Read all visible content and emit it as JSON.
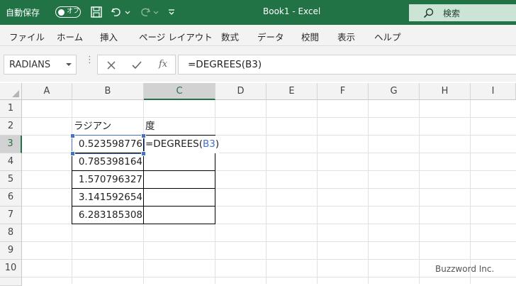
{
  "title_bar": {
    "autosave_label": "自動保存",
    "autosave_state": "オフ",
    "title": "Book1 - Excel",
    "search_placeholder": "検索"
  },
  "ribbon": {
    "tabs": [
      "ファイル",
      "ホーム",
      "挿入",
      "ページ レイアウト",
      "数式",
      "データ",
      "校閲",
      "表示",
      "ヘルプ"
    ]
  },
  "formula_bar": {
    "name_box": "RADIANS",
    "fx_label": "fx",
    "formula": "=DEGREES(B3)"
  },
  "sheet": {
    "columns": [
      "A",
      "B",
      "C",
      "D",
      "E",
      "F",
      "G",
      "H",
      "I"
    ],
    "rows": [
      "1",
      "2",
      "3",
      "4",
      "5",
      "6",
      "7",
      "8",
      "9",
      "10"
    ],
    "header_radian": "ラジアン",
    "header_degree": "度",
    "radians": [
      "0.523598776",
      "0.785398164",
      "1.570796327",
      "3.141592654",
      "6.283185308"
    ],
    "editing_prefix": "=DEGREES(",
    "editing_ref": "B3",
    "editing_suffix": ")",
    "active_cell": "C3",
    "selection_color": "#4472c4"
  },
  "watermark": "Buzzword Inc.",
  "colors": {
    "accent": "#217346"
  }
}
